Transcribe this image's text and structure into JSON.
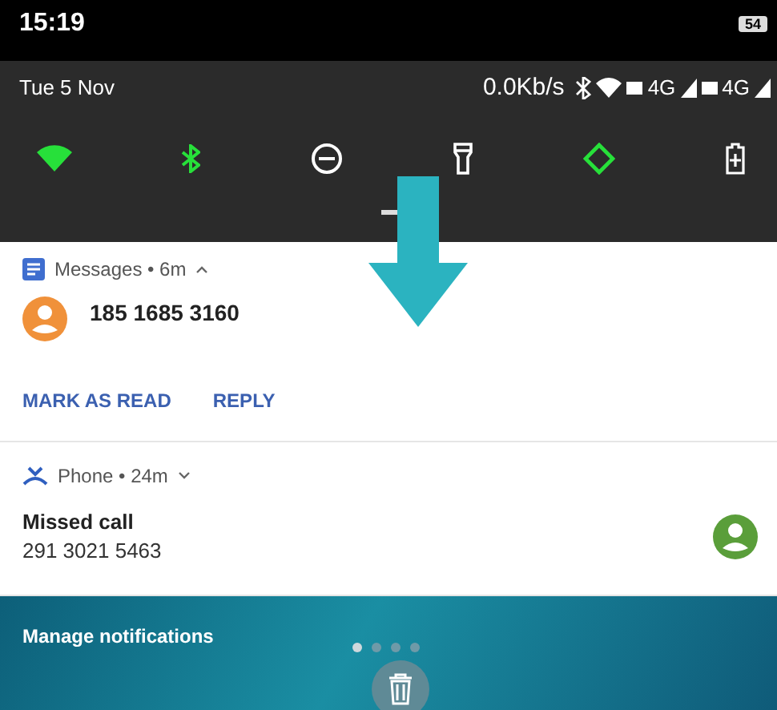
{
  "status_bar": {
    "time": "15:19",
    "battery": "54"
  },
  "shade": {
    "date": "Tue 5 Nov",
    "net_speed": "0.0Kb/s",
    "network_labels": [
      "4G",
      "4G"
    ]
  },
  "toggles": [
    {
      "kind": "wifi",
      "on": true
    },
    {
      "kind": "bluetooth",
      "on": true
    },
    {
      "kind": "dnd",
      "on": false
    },
    {
      "kind": "flashlight",
      "on": false
    },
    {
      "kind": "rotation",
      "on": true
    },
    {
      "kind": "battery-saver",
      "on": false
    }
  ],
  "notifications": [
    {
      "kind": "message",
      "header": "Messages • 6m",
      "expanded": true,
      "title": "185 1685 3160",
      "color": "#f0913a",
      "actions": [
        "MARK AS READ",
        "REPLY"
      ]
    },
    {
      "kind": "call",
      "header": "Phone • 24m",
      "expanded": false,
      "title": "Missed call",
      "text": "291 3021 5463",
      "color": "#5a9e3a"
    }
  ],
  "footer": {
    "label": "Manage notifications"
  }
}
